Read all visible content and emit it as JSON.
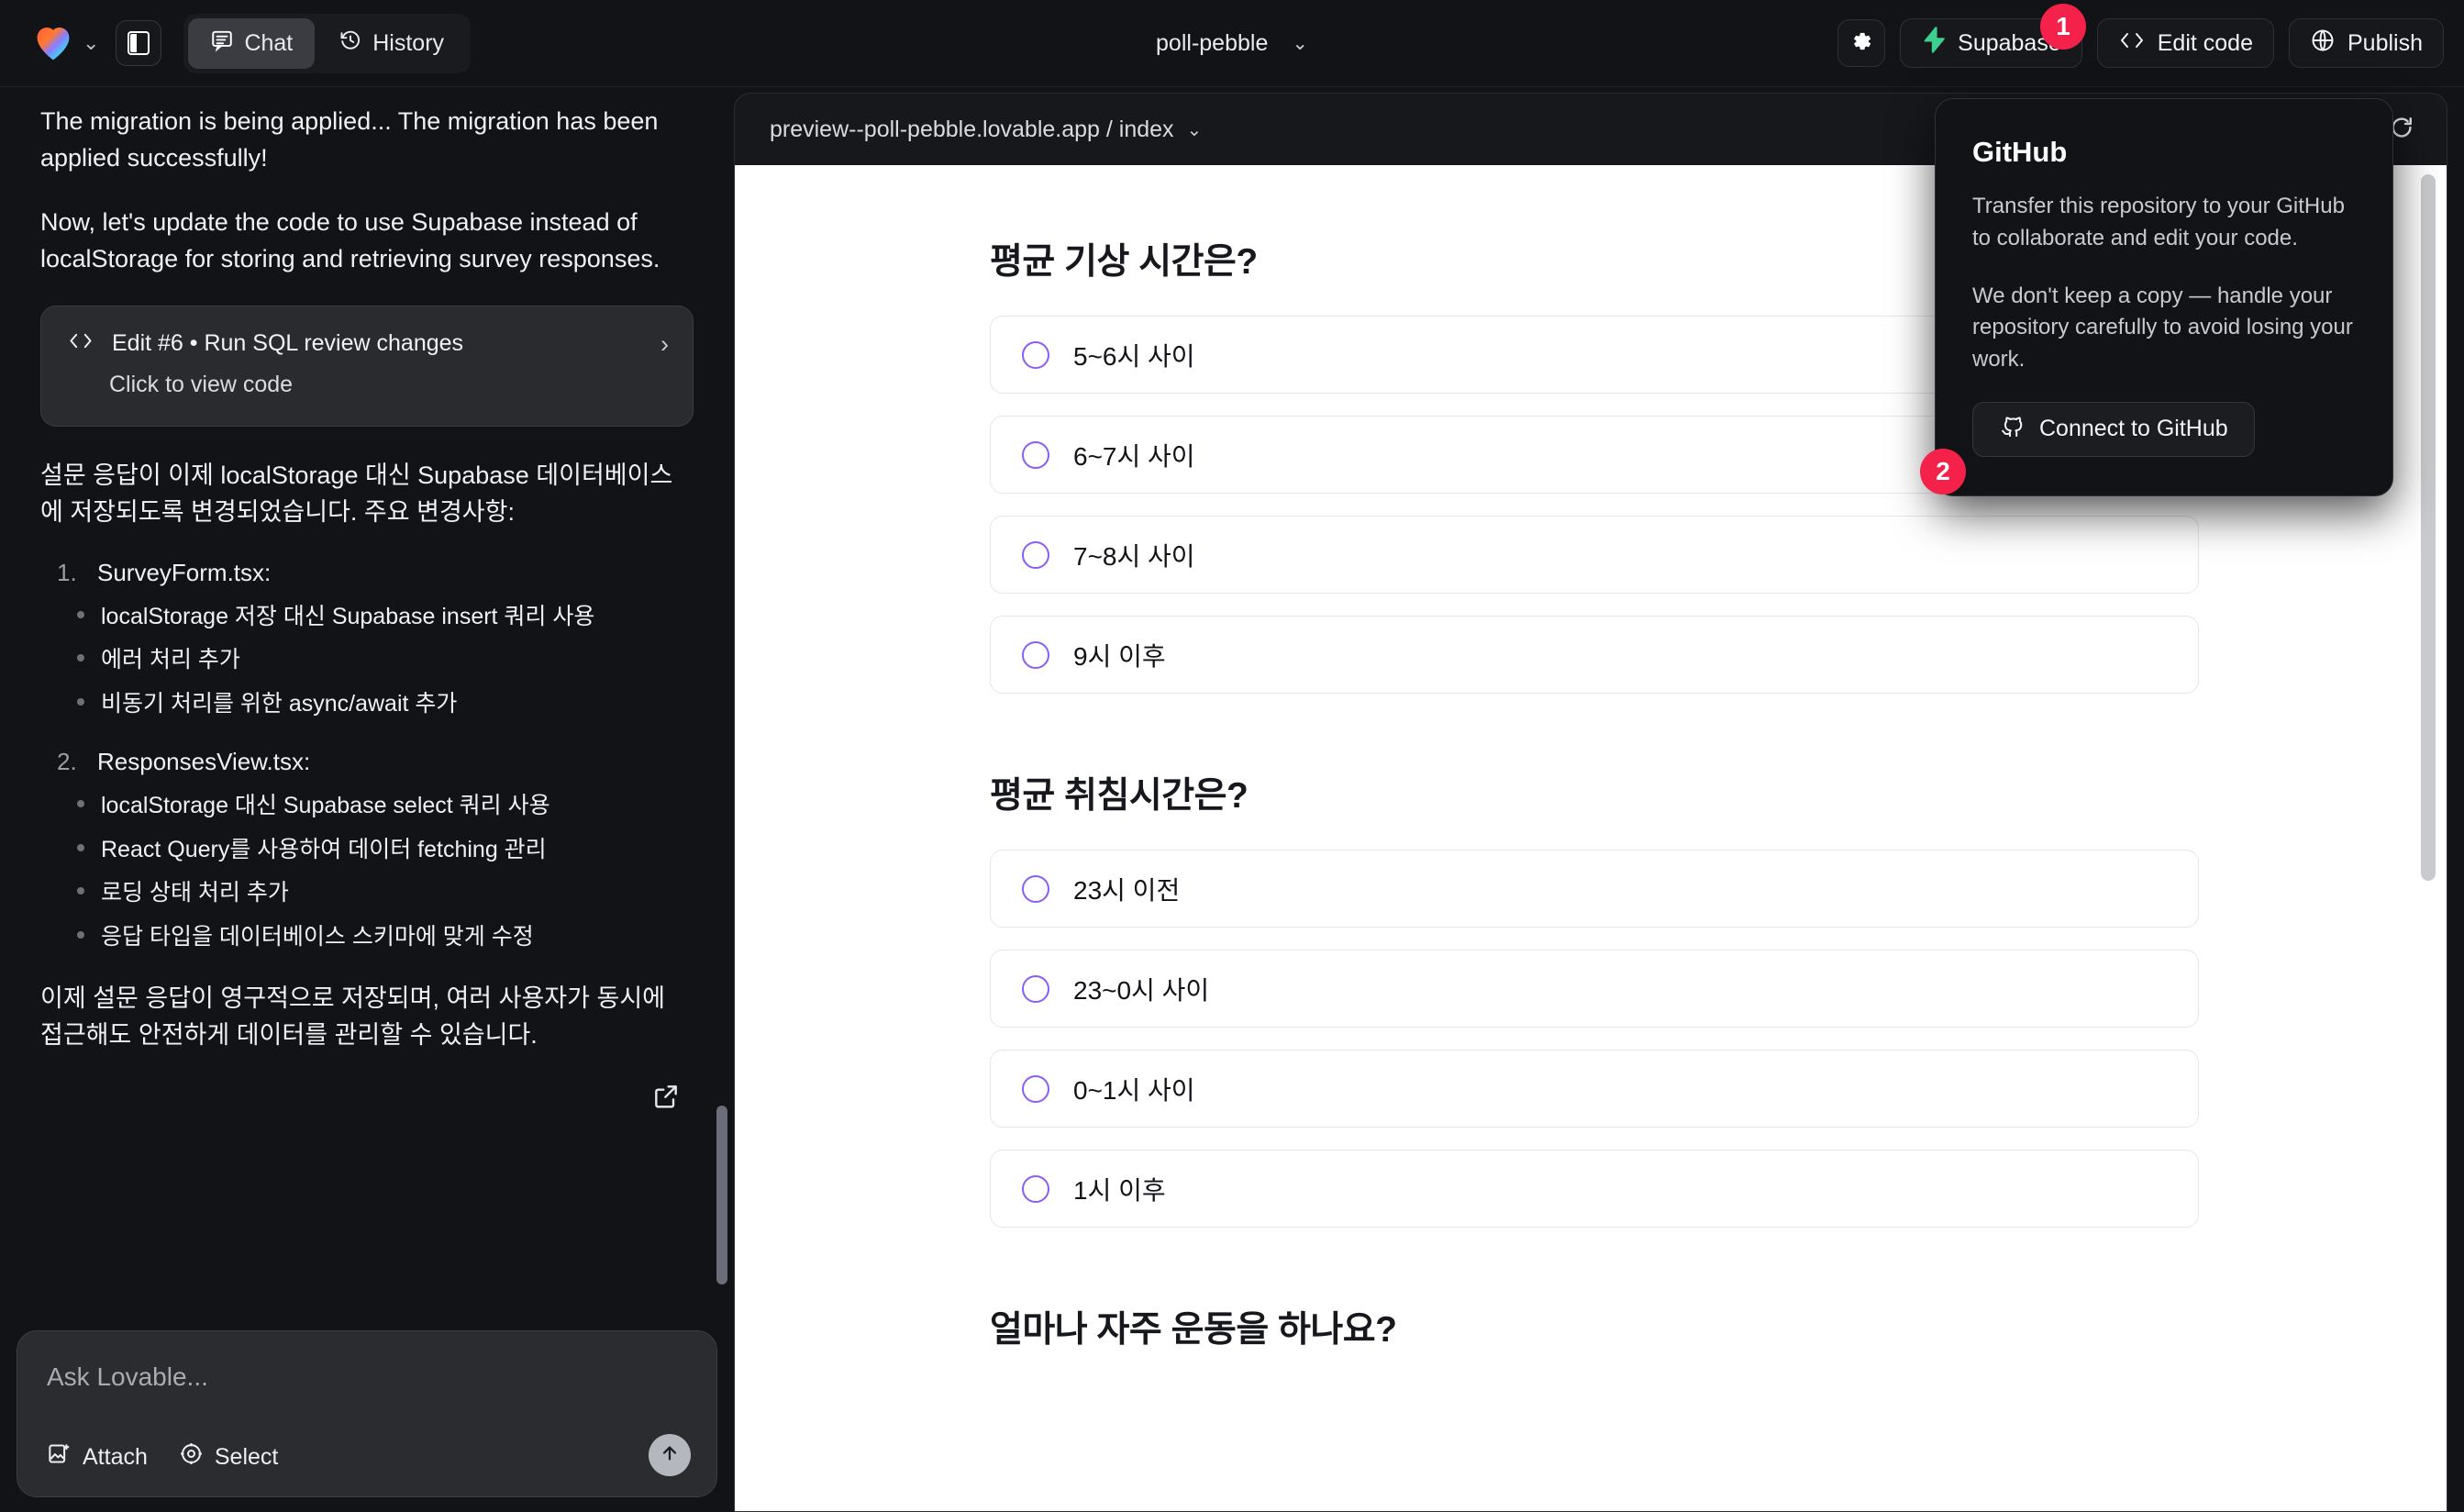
{
  "topbar": {
    "logo_icon": "lovable-heart-logo",
    "logo_chevron_icon": "chevron-down-icon",
    "panel_toggle_icon": "sidebar-panel-icon",
    "tabs": [
      {
        "label": "Chat",
        "icon": "chat-bubble-icon",
        "active": true
      },
      {
        "label": "History",
        "icon": "history-clock-icon",
        "active": false
      }
    ],
    "project_name": "poll-pebble",
    "project_chevron_icon": "chevron-down-icon",
    "settings_icon": "gear-icon",
    "supabase_label": "Supabase",
    "supabase_icon": "supabase-bolt-icon",
    "edit_code_label": "Edit code",
    "edit_code_icon": "angle-brackets-icon",
    "publish_label": "Publish",
    "publish_icon": "globe-icon"
  },
  "annotations": {
    "badge_one": "1",
    "badge_two": "2"
  },
  "colors": {
    "badge_red": "#f4224a",
    "supabase_green": "#3ecf8e",
    "radio_purple": "#8b5cf6",
    "app_background": "#121316",
    "preview_background": "#ffffff"
  },
  "chat": {
    "paragraph_1": "The migration is being applied... The migration has been applied successfully!",
    "paragraph_2": "Now, let's update the code to use Supabase instead of localStorage for storing and retrieving survey responses.",
    "edit_card": {
      "code_icon": "angle-brackets-icon",
      "title": "Edit #6 • Run SQL review changes",
      "subtitle": "Click to view code",
      "chevron_icon": "chevron-right-icon"
    },
    "paragraph_3": "설문 응답이 이제 localStorage 대신 Supabase 데이터베이스에 저장되도록 변경되었습니다. 주요 변경사항:",
    "sections": [
      {
        "number": "1.",
        "heading": "SurveyForm.tsx:",
        "bullets": [
          "localStorage 저장 대신 Supabase insert 쿼리 사용",
          "에러 처리 추가",
          "비동기 처리를 위한 async/await 추가"
        ]
      },
      {
        "number": "2.",
        "heading": "ResponsesView.tsx:",
        "bullets": [
          "localStorage 대신 Supabase select 쿼리 사용",
          "React Query를 사용하여 데이터 fetching 관리",
          "로딩 상태 처리 추가",
          "응답 타입을 데이터베이스 스키마에 맞게 수정"
        ]
      }
    ],
    "paragraph_4": "이제 설문 응답이 영구적으로 저장되며, 여러 사용자가 동시에 접근해도 안전하게 데이터를 관리할 수 있습니다.",
    "external_link_icon": "open-external-icon",
    "scrollbar": "chat-scrollbar"
  },
  "composer": {
    "placeholder": "Ask Lovable...",
    "value": "",
    "attach_label": "Attach",
    "attach_icon": "image-attach-icon",
    "select_label": "Select",
    "select_icon": "target-select-icon",
    "send_icon": "arrow-up-icon"
  },
  "preview": {
    "url": "preview--poll-pebble.lovable.app / index",
    "url_chevron_icon": "chevron-down-icon",
    "refresh_icon": "reload-icon",
    "scrollbar": "preview-scrollbar",
    "questions": [
      {
        "title": "평균 기상 시간은?",
        "options": [
          "5~6시 사이",
          "6~7시 사이",
          "7~8시 사이",
          "9시 이후"
        ]
      },
      {
        "title": "평균 취침시간은?",
        "options": [
          "23시 이전",
          "23~0시 사이",
          "0~1시 사이",
          "1시 이후"
        ]
      },
      {
        "title": "얼마나 자주 운동을 하나요?",
        "options": []
      }
    ]
  },
  "github_popover": {
    "title": "GitHub",
    "body_1": "Transfer this repository to your GitHub to collaborate and edit your code.",
    "body_2": "We don't keep a copy — handle your repository carefully to avoid losing your work.",
    "button_label": "Connect to GitHub",
    "button_icon": "github-mark-icon"
  }
}
